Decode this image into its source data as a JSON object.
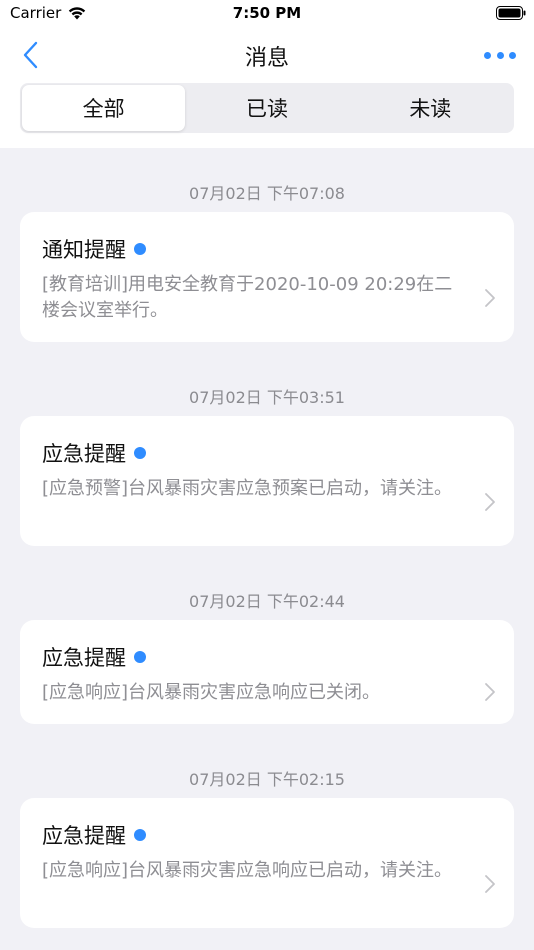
{
  "status_bar": {
    "carrier": "Carrier",
    "time": "7:50 PM"
  },
  "nav": {
    "title": "消息",
    "back_icon": "chevron-left-icon",
    "more_icon": "more-dots-icon",
    "accent_color": "#2f8cff"
  },
  "tabs": [
    {
      "label": "全部",
      "selected": true
    },
    {
      "label": "已读",
      "selected": false
    },
    {
      "label": "未读",
      "selected": false
    }
  ],
  "messages": [
    {
      "time": "07月02日 下午07:08",
      "title": "通知提醒",
      "body": "[教育培训]用电安全教育于2020-10-09 20:29在二楼会议室举行。",
      "unread": true
    },
    {
      "time": "07月02日 下午03:51",
      "title": "应急提醒",
      "body": "[应急预警]台风暴雨灾害应急预案已启动，请关注。",
      "unread": true
    },
    {
      "time": "07月02日 下午02:44",
      "title": "应急提醒",
      "body": "[应急响应]台风暴雨灾害应急响应已关闭。",
      "unread": true
    },
    {
      "time": "07月02日 下午02:15",
      "title": "应急提醒",
      "body": "[应急响应]台风暴雨灾害应急响应已启动，请关注。",
      "unread": true
    }
  ]
}
